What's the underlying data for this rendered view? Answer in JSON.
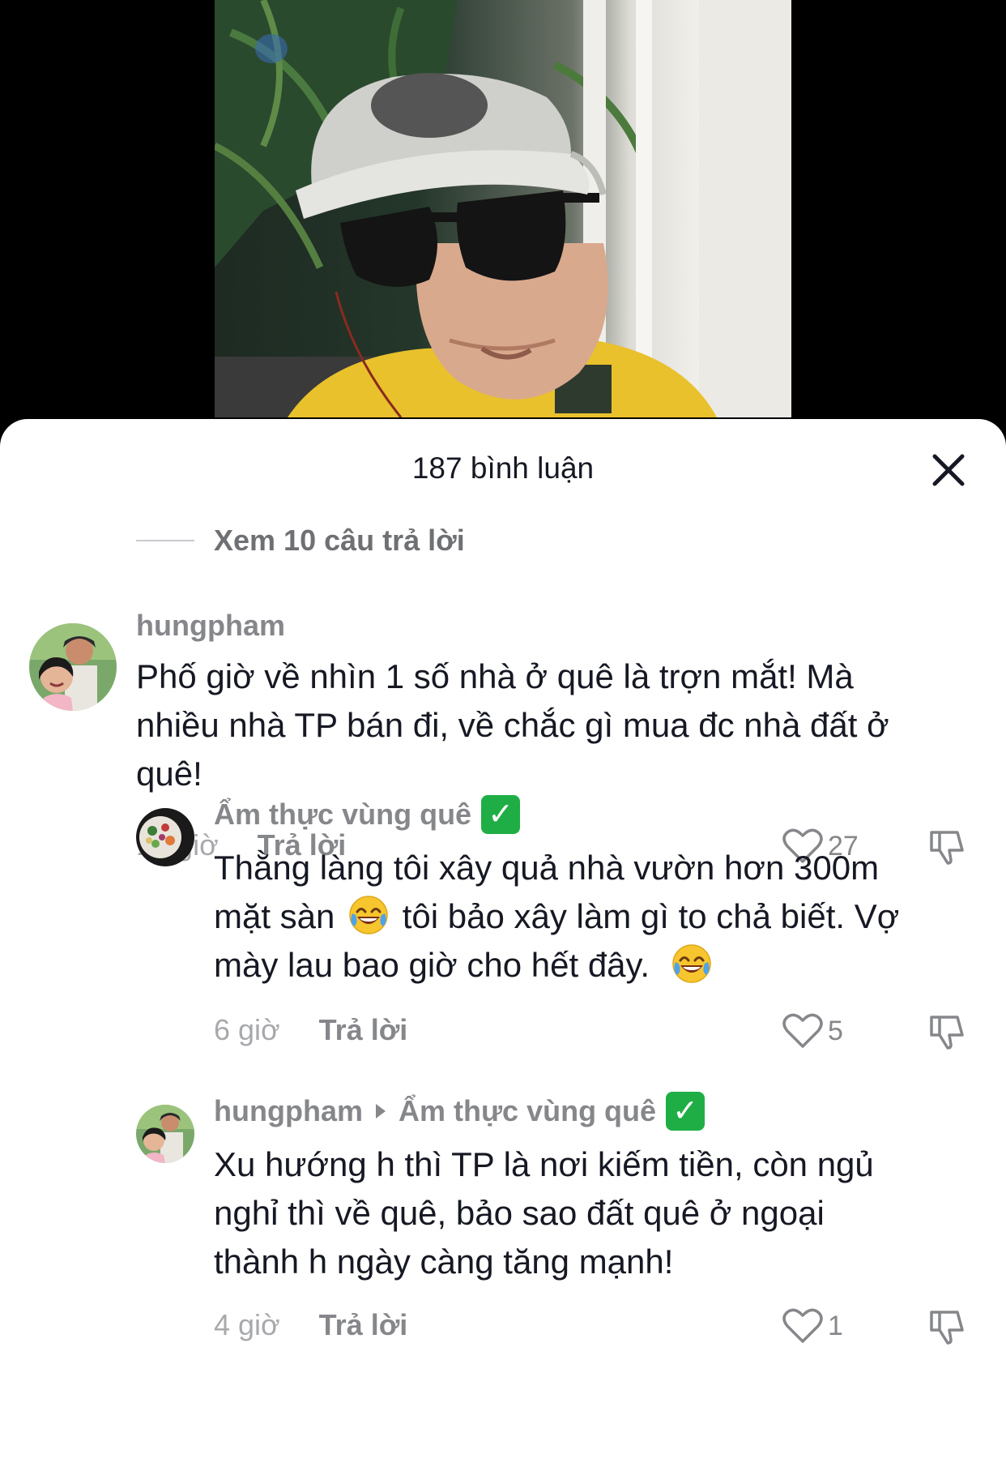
{
  "sheet": {
    "title": "187 bình luận"
  },
  "view_replies": {
    "label": "Xem 10 câu trả lời"
  },
  "comments": [
    {
      "username": "hungpham",
      "text_lines": [
        "Phố giờ về nhìn 1 số nhà ở quê là trợn mắt! Mà",
        "nhiều nhà TP bán đi, về chắc gì mua đc nhà đất ở",
        "quê!"
      ],
      "time": "17 giờ",
      "reply_label": "Trả lời",
      "likes": "27"
    },
    {
      "username": "Ẩm thực vùng quê",
      "verified_mark": "✓",
      "text_line_1": "Thằng làng tôi xây quả nhà vườn hơn 300m",
      "text_line_2a": "mặt sàn",
      "text_line_2b": "tôi bảo xây làm gì to chả biết. Vợ",
      "text_line_3": "mày lau bao giờ cho hết đây.",
      "emoji": "face-with-tears-of-joy",
      "time": "6 giờ",
      "reply_label": "Trả lời",
      "likes": "5"
    },
    {
      "username": "hungpham",
      "reply_to": "Ẩm thực vùng quê",
      "verified_mark": "✓",
      "text_lines": [
        "Xu hướng h thì TP là nơi kiếm tiền, còn ngủ",
        "nghỉ thì về quê, bảo sao đất quê ở ngoại",
        "thành h ngày càng tăng mạnh!"
      ],
      "time": "4 giờ",
      "reply_label": "Trả lời",
      "likes": "1"
    }
  ],
  "colors": {
    "sheet_bg": "#ffffff",
    "text_primary": "#161823",
    "text_secondary": "#86878b",
    "verified_green": "#1fae45"
  }
}
